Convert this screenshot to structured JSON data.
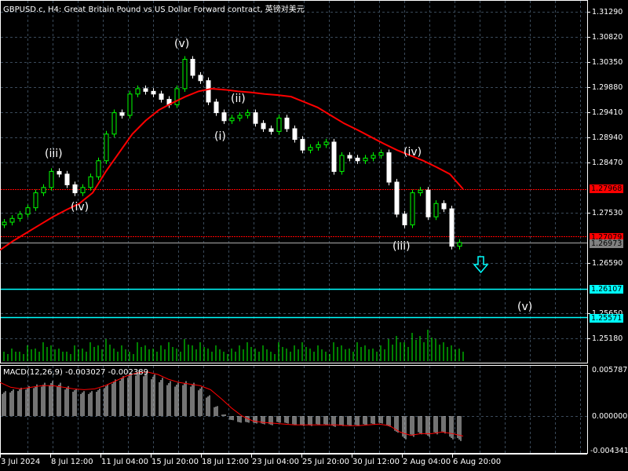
{
  "header": {
    "title": "GBPUSD.c, H4:  Great Britain Pound vs US Dollar Forward contract, 英镑对美元"
  },
  "macd": {
    "title": "MACD(12,26,9) -0.003027 -0.002389",
    "axis_labels": [
      "0.005787",
      "0.000000",
      "-0.004341"
    ]
  },
  "colors": {
    "background": "#000000",
    "bull": "#00ff00",
    "bear": "#ffffff",
    "ma": "#ff0000",
    "level_red": "#ff0000",
    "level_cyan": "#00ffff",
    "bid": "#808080",
    "grid": "#3a4a5a",
    "histogram": "#c0c0c0"
  },
  "waves": [
    "(v)",
    "(iii)",
    "(iv)",
    "(ii)",
    "(i)",
    "(iv)",
    "(iii)",
    "(v)"
  ],
  "levels": {
    "resistance": "1.27968",
    "red_level": "1.27079",
    "bid": "1.26973",
    "cyan_1": "1.26107",
    "cyan_2": "1.25571"
  },
  "chart_data": {
    "type": "candlestick",
    "symbol": "GBPUSD.c",
    "timeframe": "H4",
    "price_ticks": [
      "1.31290",
      "1.30820",
      "1.30350",
      "1.29880",
      "1.29410",
      "1.28940",
      "1.28470",
      "1.27530",
      "1.26590",
      "1.25650",
      "1.25180"
    ],
    "time_ticks": [
      "3 Jul 2024",
      "8 Jul 12:00",
      "11 Jul 04:00",
      "15 Jul 20:00",
      "18 Jul 12:00",
      "23 Jul 04:00",
      "25 Jul 20:00",
      "30 Jul 12:00",
      "2 Aug 04:00",
      "6 Aug 20:00"
    ],
    "closes": [
      1.2735,
      1.2742,
      1.275,
      1.2762,
      1.279,
      1.28,
      1.283,
      1.2825,
      1.2805,
      1.279,
      1.28,
      1.282,
      1.285,
      1.29,
      1.294,
      1.2935,
      1.2975,
      1.2985,
      1.298,
      1.2975,
      1.2965,
      1.2955,
      1.2985,
      1.304,
      1.301,
      1.3,
      1.296,
      1.294,
      1.2925,
      1.293,
      1.2935,
      1.294,
      1.292,
      1.291,
      1.2905,
      1.293,
      1.291,
      1.289,
      1.287,
      1.2875,
      1.288,
      1.2885,
      1.283,
      1.286,
      1.2855,
      1.285,
      1.2855,
      1.286,
      1.2865,
      1.281,
      1.275,
      1.273,
      1.279,
      1.2795,
      1.2745,
      1.277,
      1.276,
      1.269,
      1.2697
    ],
    "ma": [
      1.2683,
      1.27,
      1.2715,
      1.273,
      1.2745,
      1.2758,
      1.277,
      1.279,
      1.283,
      1.2865,
      1.29,
      1.2925,
      1.2945,
      1.2958,
      1.297,
      1.298,
      1.2985,
      1.2983,
      1.298,
      1.2978,
      1.2975,
      1.2973,
      1.297,
      1.296,
      1.295,
      1.2935,
      1.292,
      1.2908,
      1.2895,
      1.2882,
      1.287,
      1.286,
      1.285,
      1.2838,
      1.2825,
      1.2797
    ],
    "volumes": [
      3,
      4,
      3,
      5,
      4,
      6,
      5,
      4,
      3,
      5,
      4,
      6,
      5,
      7,
      4,
      5,
      3,
      6,
      5,
      4,
      5,
      6,
      4,
      7,
      5,
      6,
      4,
      5,
      3,
      4,
      5,
      6,
      4,
      5,
      3,
      6,
      4,
      5,
      6,
      4,
      5,
      3,
      6,
      5,
      4,
      6,
      5,
      4,
      5,
      7,
      8,
      6,
      9,
      8,
      10,
      7,
      6,
      5,
      4
    ],
    "macd_hist": [
      0.003,
      0.0032,
      0.0034,
      0.0036,
      0.0038,
      0.004,
      0.0042,
      0.004,
      0.0036,
      0.0033,
      0.003,
      0.003,
      0.0033,
      0.0038,
      0.0044,
      0.0048,
      0.0052,
      0.0055,
      0.0054,
      0.005,
      0.0046,
      0.0042,
      0.004,
      0.0042,
      0.004,
      0.0035,
      0.0025,
      0.0012,
      0.0002,
      -0.0005,
      -0.0008,
      -0.0008,
      -0.0009,
      -0.001,
      -0.0011,
      -0.0008,
      -0.0009,
      -0.0011,
      -0.0012,
      -0.0012,
      -0.0011,
      -0.0011,
      -0.0013,
      -0.0012,
      -0.0012,
      -0.0012,
      -0.0011,
      -0.001,
      -0.0009,
      -0.0013,
      -0.002,
      -0.0028,
      -0.0025,
      -0.0022,
      -0.0025,
      -0.0022,
      -0.0021,
      -0.0028,
      -0.003
    ],
    "macd_signal": [
      0.0042,
      0.0036,
      0.0034,
      0.0036,
      0.0038,
      0.0038,
      0.0036,
      0.0034,
      0.0033,
      0.0034,
      0.0038,
      0.0044,
      0.005,
      0.0054,
      0.0055,
      0.0052,
      0.0046,
      0.0042,
      0.004,
      0.0038,
      0.0033,
      0.0022,
      0.001,
      0.0,
      -0.0006,
      -0.0008,
      -0.0009,
      -0.001,
      -0.0011,
      -0.0011,
      -0.0011,
      -0.0011,
      -0.0011,
      -0.0012,
      -0.0012,
      -0.0011,
      -0.001,
      -0.0012,
      -0.002,
      -0.0024,
      -0.0022,
      -0.0022,
      -0.002,
      -0.0022,
      -0.0025
    ],
    "ylim": [
      1.25,
      1.314
    ],
    "macd_ylim": [
      -0.004341,
      0.005787
    ]
  }
}
